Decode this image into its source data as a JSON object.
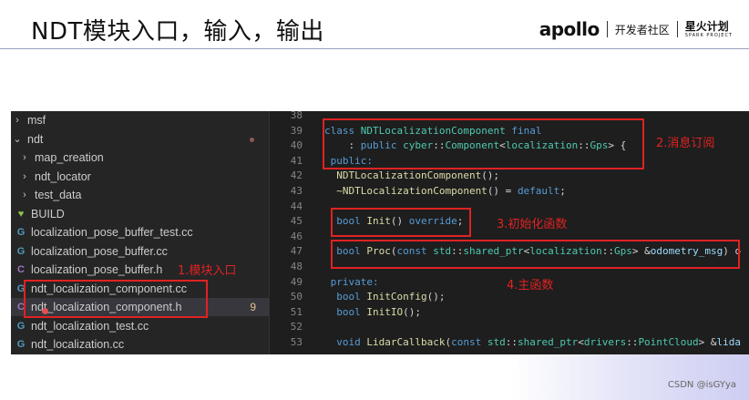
{
  "slide": {
    "title": "NDT模块入口，输入，输出",
    "brand_logo": "apollo",
    "brand_community": "开发者社区",
    "brand_spark_cn": "星火计划",
    "brand_spark_en": "SPARK PROJECT",
    "watermark": "CSDN @isGYya"
  },
  "explorer": {
    "items": [
      {
        "label": "msf",
        "icon": "chevron-right-icon"
      },
      {
        "label": "ndt",
        "icon": "chevron-down-icon",
        "modified_dot": true
      },
      {
        "label": "map_creation",
        "icon": "chevron-right-icon"
      },
      {
        "label": "ndt_locator",
        "icon": "chevron-right-icon"
      },
      {
        "label": "test_data",
        "icon": "chevron-right-icon"
      },
      {
        "label": "BUILD",
        "icon": "heart-icon"
      },
      {
        "label": "localization_pose_buffer_test.cc",
        "icon": "cpp-file-icon"
      },
      {
        "label": "localization_pose_buffer.cc",
        "icon": "cpp-file-icon"
      },
      {
        "label": "localization_pose_buffer.h",
        "icon": "header-file-icon"
      },
      {
        "label": "ndt_localization_component.cc",
        "icon": "cpp-file-icon"
      },
      {
        "label": "ndt_localization_component.h",
        "icon": "header-file-icon",
        "badge": "9"
      },
      {
        "label": "ndt_localization_test.cc",
        "icon": "cpp-file-icon"
      },
      {
        "label": "ndt_localization.cc",
        "icon": "cpp-file-icon"
      }
    ]
  },
  "editor": {
    "line_numbers": [
      "38",
      "39",
      "40",
      "41",
      "42",
      "43",
      "44",
      "45",
      "46",
      "47",
      "48",
      "49",
      "50",
      "51",
      "52",
      "53"
    ]
  },
  "annotations": {
    "a1": "1.模块入口",
    "a2": "2.消息订阅",
    "a3": "3.初始化函数",
    "a4": "4.主函数"
  },
  "colors": {
    "annotation_red": "#e02222",
    "editor_bg": "#1e1e1e",
    "sidebar_bg": "#252526"
  }
}
